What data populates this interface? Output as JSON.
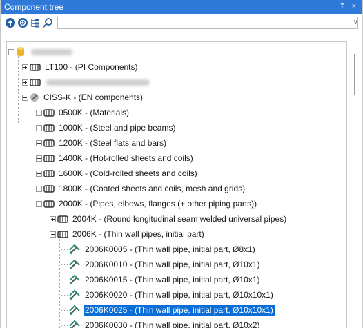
{
  "panel": {
    "title": "Component tree",
    "controls": "↥ ×",
    "search_value": "",
    "accent": "#2f7ad8",
    "selection_color": "#0a6ed6"
  },
  "toolbar": {
    "buttons": [
      "arrow-up-circle-icon",
      "add-circle-icon",
      "expand-tree-icon",
      "search-icon"
    ]
  },
  "tree": {
    "rows": [
      {
        "label": ""
      },
      {
        "label": "LT100 - (PI Components)"
      },
      {
        "label": ""
      },
      {
        "label": "CISS-K - (EN components)"
      },
      {
        "label": "0500K - (Materials)"
      },
      {
        "label": "1000K - (Steel and pipe beams)"
      },
      {
        "label": "1200K - (Steel flats and bars)"
      },
      {
        "label": "1400K - (Hot-rolled sheets and coils)"
      },
      {
        "label": "1600K - (Cold-rolled sheets and coils)"
      },
      {
        "label": "1800K - (Coated sheets and coils, mesh and grids)"
      },
      {
        "label": "2000K - (Pipes, elbows, flanges (+ other piping parts))"
      },
      {
        "label": "2004K - (Round longitudinal seam welded universal pipes)"
      },
      {
        "label": "2006K - (Thin wall pipes, initial part)"
      },
      {
        "label": "2006K0005 - (Thin wall pipe, initial part, Ø8x1)"
      },
      {
        "label": "2006K0010 - (Thin wall pipe, initial part, Ø10x1)"
      },
      {
        "label": "2006K0015 - (Thin wall pipe, initial part, Ø10x1)"
      },
      {
        "label": "2006K0020 - (Thin wall pipe, initial part, Ø10x10x1)"
      },
      {
        "label": "2006K0025 - (Thin wall pipe, initial part, Ø10x10x1)"
      },
      {
        "label": "2006K0030 - (Thin wall pipe, initial part, Ø10x2)"
      }
    ]
  }
}
